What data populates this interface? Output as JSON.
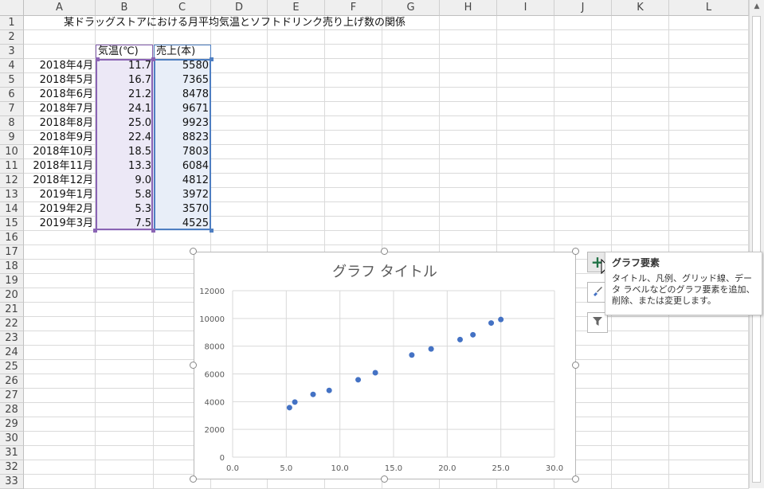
{
  "columns": [
    "A",
    "B",
    "C",
    "D",
    "E",
    "F",
    "G",
    "H",
    "I",
    "J",
    "K",
    "L"
  ],
  "rows": [
    "1",
    "2",
    "3",
    "4",
    "5",
    "6",
    "7",
    "8",
    "9",
    "10",
    "11",
    "12",
    "13",
    "14",
    "15",
    "16",
    "17",
    "18",
    "19",
    "20",
    "21",
    "22",
    "23",
    "24",
    "25",
    "26",
    "27",
    "28",
    "29",
    "30",
    "31",
    "32",
    "33"
  ],
  "sheet": {
    "title": "某ドラッグストアにおける月平均気温とソフトドリンク売り上げ数の関係",
    "header_temp": "気温(℃)",
    "header_sales": "売上(本)",
    "table": [
      {
        "month": "2018年4月",
        "temp": "11.7",
        "sales": "5580"
      },
      {
        "month": "2018年5月",
        "temp": "16.7",
        "sales": "7365"
      },
      {
        "month": "2018年6月",
        "temp": "21.2",
        "sales": "8478"
      },
      {
        "month": "2018年7月",
        "temp": "24.1",
        "sales": "9671"
      },
      {
        "month": "2018年8月",
        "temp": "25.0",
        "sales": "9923"
      },
      {
        "month": "2018年9月",
        "temp": "22.4",
        "sales": "8823"
      },
      {
        "month": "2018年10月",
        "temp": "18.5",
        "sales": "7803"
      },
      {
        "month": "2018年11月",
        "temp": "13.3",
        "sales": "6084"
      },
      {
        "month": "2018年12月",
        "temp": "9.0",
        "sales": "4812"
      },
      {
        "month": "2019年1月",
        "temp": "5.8",
        "sales": "3972"
      },
      {
        "month": "2019年2月",
        "temp": "5.3",
        "sales": "3570"
      },
      {
        "month": "2019年3月",
        "temp": "7.5",
        "sales": "4525"
      }
    ]
  },
  "chart_data": {
    "type": "scatter",
    "title": "グラフ タイトル",
    "x": [
      11.7,
      16.7,
      21.2,
      24.1,
      25.0,
      22.4,
      18.5,
      13.3,
      9.0,
      5.8,
      5.3,
      7.5
    ],
    "y": [
      5580,
      7365,
      8478,
      9671,
      9923,
      8823,
      7803,
      6084,
      4812,
      3972,
      3570,
      4525
    ],
    "xlim": [
      0,
      30
    ],
    "ylim": [
      0,
      12000
    ],
    "xticks": [
      "0.0",
      "5.0",
      "10.0",
      "15.0",
      "20.0",
      "25.0",
      "30.0"
    ],
    "yticks": [
      "0",
      "2000",
      "4000",
      "6000",
      "8000",
      "10000",
      "12000"
    ],
    "grid": true,
    "point_color": "#4472c4"
  },
  "chart_tools": {
    "elements_icon": "plus-icon",
    "styles_icon": "brush-icon",
    "filter_icon": "filter-icon"
  },
  "tooltip": {
    "title": "グラフ要素",
    "body": "タイトル、凡例、グリッド線、データ ラベルなどのグラフ要素を追加、削除、または変更します。"
  },
  "colors": {
    "accent_green": "#217346",
    "sel_purple": "#8a64b4",
    "sel_blue": "#4f7fc2"
  }
}
